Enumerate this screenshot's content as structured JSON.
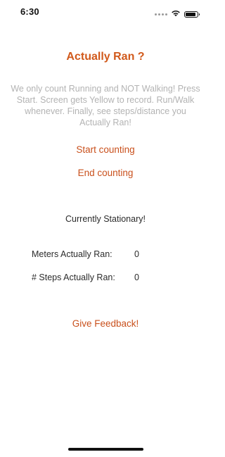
{
  "status_bar": {
    "time": "6:30",
    "icons": [
      "cellular-signal-icon",
      "wifi-icon",
      "battery-icon"
    ]
  },
  "app": {
    "title": "Actually Ran ?",
    "instructions": "We only count Running and NOT Walking! Press Start. Screen gets Yellow to record. Run/Walk whenever. Finally, see steps/distance you Actually Ran!",
    "start_label": "Start counting",
    "end_label": "End counting",
    "activity_state": "Currently Stationary!",
    "meters_label": "Meters Actually Ran:",
    "meters_value": "0",
    "steps_label": "# Steps Actually Ran:",
    "steps_value": "0",
    "feedback_label": "Give Feedback!"
  },
  "colors": {
    "accent": "#d1591b",
    "muted_text": "#b3b3b3",
    "body_text": "#2b2b2b",
    "background": "#ffffff"
  }
}
